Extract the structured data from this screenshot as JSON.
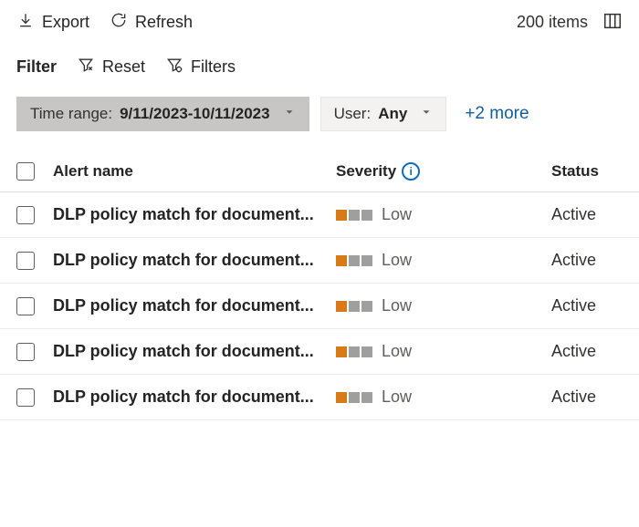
{
  "toolbar": {
    "export_label": "Export",
    "refresh_label": "Refresh",
    "items_count": "200 items"
  },
  "filter": {
    "label": "Filter",
    "reset_label": "Reset",
    "filters_label": "Filters"
  },
  "chips": {
    "time_label": "Time range:",
    "time_value": "9/11/2023-10/11/2023",
    "user_label": "User:",
    "user_value": "Any",
    "more_label": "+2 more"
  },
  "columns": {
    "alert_name": "Alert name",
    "severity": "Severity",
    "status": "Status"
  },
  "rows": [
    {
      "name": "DLP policy match for document...",
      "severity": "Low",
      "status": "Active"
    },
    {
      "name": "DLP policy match for document...",
      "severity": "Low",
      "status": "Active"
    },
    {
      "name": "DLP policy match for document...",
      "severity": "Low",
      "status": "Active"
    },
    {
      "name": "DLP policy match for document...",
      "severity": "Low",
      "status": "Active"
    },
    {
      "name": "DLP policy match for document...",
      "severity": "Low",
      "status": "Active"
    }
  ]
}
